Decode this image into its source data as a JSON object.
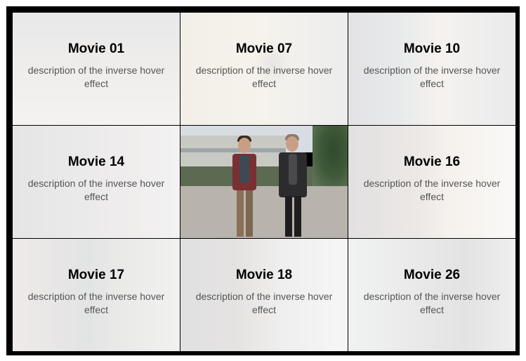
{
  "tiles": [
    {
      "title": "Movie 01",
      "description": "description of the inverse hover effect",
      "state": "dimmed"
    },
    {
      "title": "Movie 07",
      "description": "description of the inverse hover effect",
      "state": "dimmed"
    },
    {
      "title": "Movie 10",
      "description": "description of the inverse hover effect",
      "state": "dimmed"
    },
    {
      "title": "Movie 14",
      "description": "description of the inverse hover effect",
      "state": "dimmed"
    },
    {
      "title": "",
      "description": "",
      "state": "hovered"
    },
    {
      "title": "Movie 16",
      "description": "description of the inverse hover effect",
      "state": "dimmed"
    },
    {
      "title": "Movie 17",
      "description": "description of the inverse hover effect",
      "state": "dimmed"
    },
    {
      "title": "Movie 18",
      "description": "description of the inverse hover effect",
      "state": "dimmed"
    },
    {
      "title": "Movie 26",
      "description": "description of the inverse hover effect",
      "state": "dimmed"
    }
  ],
  "colors": {
    "frame": "#000000",
    "title_text": "#000000",
    "description_text": "#555555"
  }
}
